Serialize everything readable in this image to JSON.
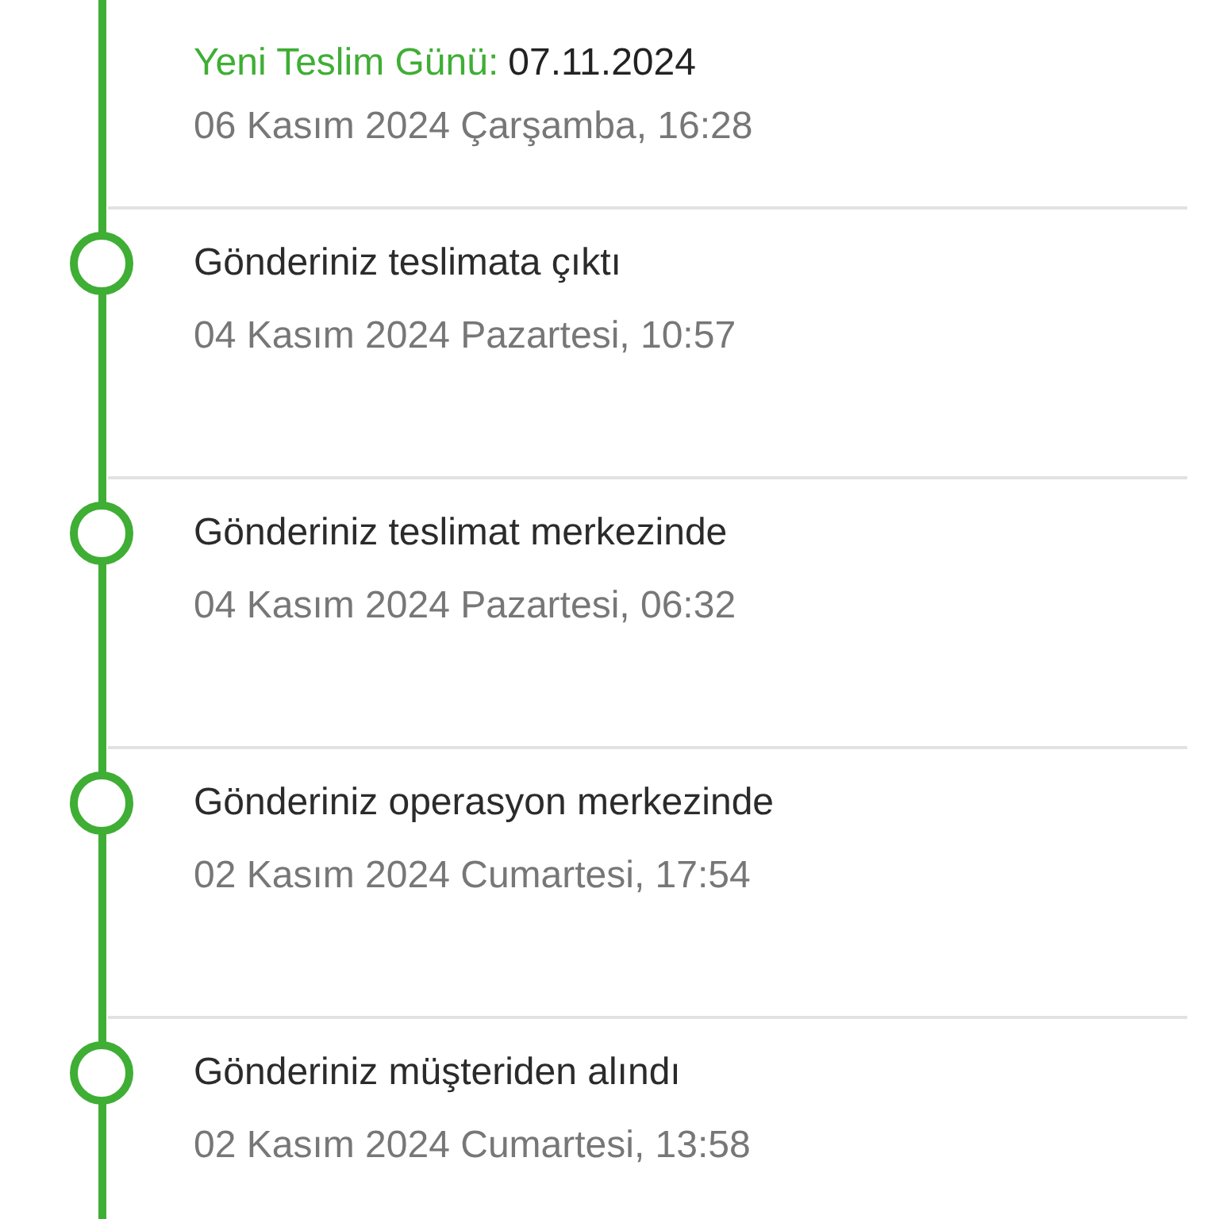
{
  "events": [
    {
      "details": [
        {
          "label": "Yeni Teslim Günü:",
          "value": "07.11.2024"
        }
      ],
      "date": "06 Kasım 2024 Çarşamba, 16:28"
    },
    {
      "title": "Gönderiniz teslimata çıktı",
      "date": "04 Kasım 2024 Pazartesi, 10:57"
    },
    {
      "title": "Gönderiniz teslimat merkezinde",
      "date": "04 Kasım 2024 Pazartesi, 06:32"
    },
    {
      "title": "Gönderiniz operasyon merkezinde",
      "date": "02 Kasım 2024 Cumartesi, 17:54"
    },
    {
      "title": "Gönderiniz müşteriden alındı",
      "date": "02 Kasım 2024 Cumartesi, 13:58"
    }
  ]
}
